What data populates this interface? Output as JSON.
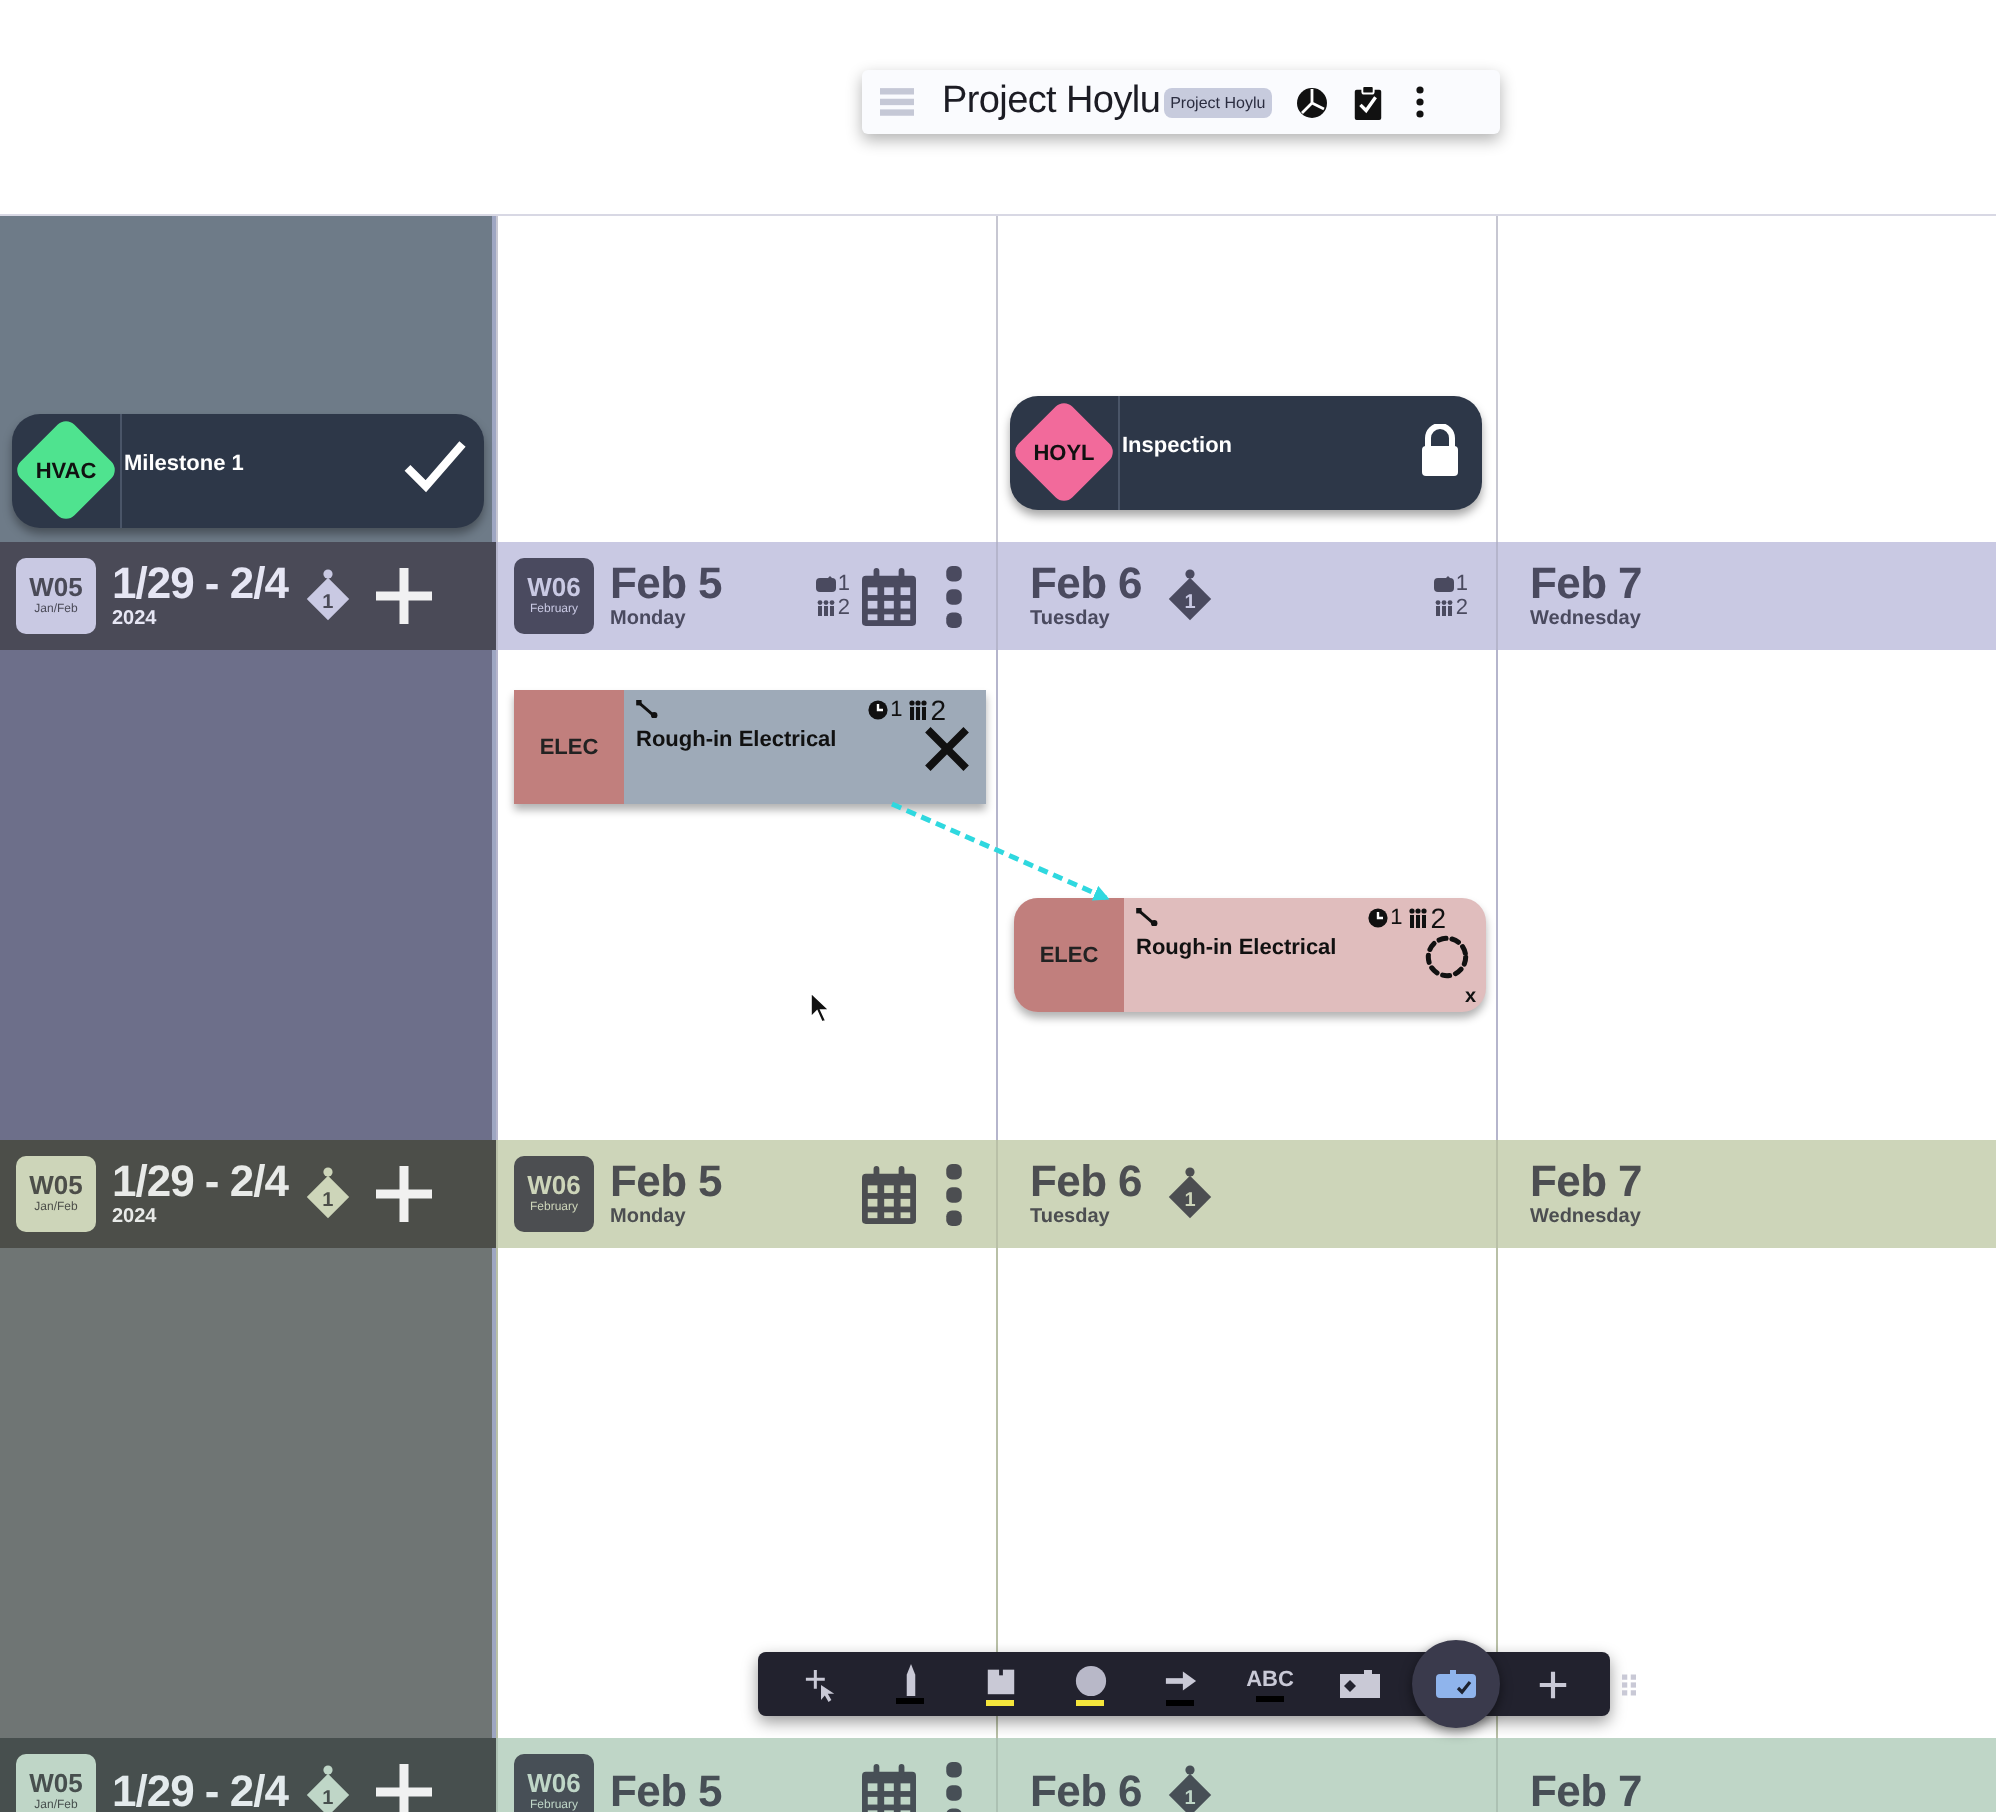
{
  "title_bar": {
    "title": "Project Hoylu",
    "badge": "Project Hoylu"
  },
  "lanes": [
    {
      "color": "#c9c9e3",
      "week": {
        "code": "W05",
        "months": "Jan/Feb",
        "range": "1/29 - 2/4",
        "year": "2024",
        "milestone_count": "1",
        "milestone": {
          "code": "HVAC",
          "name": "Milestone 1",
          "color": "#4fe38f",
          "completed": true,
          "locked": false
        }
      },
      "days": [
        {
          "week_code": "W06",
          "week_month": "February",
          "date": "Feb 5",
          "weekday": "Monday",
          "counts": [
            {
              "kind": "tag",
              "value": "1"
            },
            {
              "kind": "people",
              "value": "2"
            }
          ],
          "calendar": true,
          "menu": true,
          "tasks": [
            {
              "code": "ELEC",
              "name": "Rough-in Electrical",
              "clock": "1",
              "people": "2",
              "cancelled": true
            }
          ]
        },
        {
          "date": "Feb 6",
          "weekday": "Tuesday",
          "milestone_count": "1",
          "counts": [
            {
              "kind": "tag",
              "value": "1"
            },
            {
              "kind": "people",
              "value": "2"
            }
          ],
          "milestone": {
            "code": "HOYL",
            "name": "Inspection",
            "color": "#f26a9b",
            "completed": false,
            "locked": true
          },
          "tasks": [
            {
              "code": "ELEC",
              "name": "Rough-in Electrical",
              "clock": "1",
              "people": "2",
              "cancelled": false,
              "dependency": true,
              "close_label": "x"
            }
          ]
        },
        {
          "date": "Feb 7",
          "weekday": "Wednesday"
        }
      ]
    },
    {
      "color": "#cdd5b9",
      "week": {
        "code": "W05",
        "months": "Jan/Feb",
        "range": "1/29 - 2/4",
        "year": "2024",
        "milestone_count": "1"
      },
      "days": [
        {
          "week_code": "W06",
          "week_month": "February",
          "date": "Feb 5",
          "weekday": "Monday",
          "calendar": true,
          "menu": true
        },
        {
          "date": "Feb 6",
          "weekday": "Tuesday",
          "milestone_count": "1"
        },
        {
          "date": "Feb 7",
          "weekday": "Wednesday"
        }
      ]
    },
    {
      "color": "#bfd6c7",
      "week": {
        "code": "W05",
        "months": "Jan/Feb",
        "range": "1/29 - 2/4",
        "milestone_count": "1"
      },
      "days": [
        {
          "week_code": "W06",
          "week_month": "February",
          "date": "Feb 5",
          "calendar": true,
          "menu": true
        },
        {
          "date": "Feb 6",
          "milestone_count": "1"
        },
        {
          "date": "Feb 7"
        }
      ]
    }
  ],
  "toolbar": [
    {
      "kind": "select",
      "selected": false
    },
    {
      "kind": "marker",
      "color": "#000000",
      "selected": false
    },
    {
      "kind": "sticky",
      "color": "#f5e63c",
      "selected": false
    },
    {
      "kind": "shape",
      "color": "#f5e63c",
      "selected": false
    },
    {
      "kind": "arrow",
      "color": "#000000",
      "selected": false
    },
    {
      "kind": "text",
      "label": "ABC",
      "color": "#000000",
      "selected": false
    },
    {
      "kind": "image",
      "selected": false
    },
    {
      "kind": "task",
      "selected": true
    },
    {
      "kind": "add",
      "selected": false
    },
    {
      "kind": "grip",
      "selected": false
    }
  ]
}
